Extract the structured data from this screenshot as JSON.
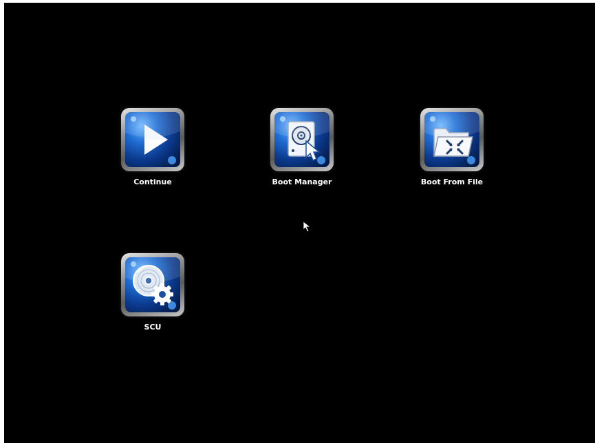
{
  "menu": {
    "items": [
      {
        "label": "Continue",
        "icon": "play-icon"
      },
      {
        "label": "Boot Manager",
        "icon": "disk-cursor-icon"
      },
      {
        "label": "Boot From File",
        "icon": "folder-icon"
      },
      {
        "label": "SCU",
        "icon": "disc-gear-icon"
      }
    ]
  },
  "colors": {
    "background": "#000000",
    "label": "#ffffff",
    "icon_blue": "#1f6fd6",
    "icon_dark": "#061f52"
  }
}
